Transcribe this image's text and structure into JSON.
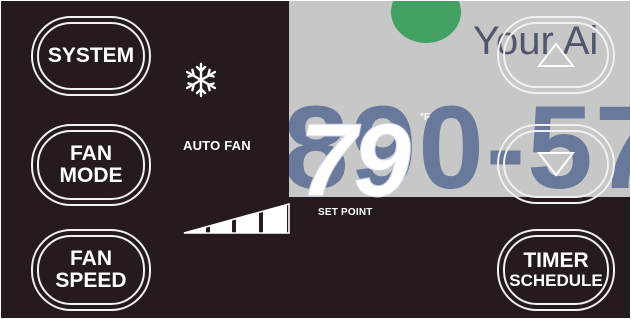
{
  "buttons": {
    "system": "SYSTEM",
    "fan_mode": [
      "FAN",
      "MODE"
    ],
    "fan_speed": [
      "FAN",
      "SPEED"
    ],
    "timer": [
      "TIMER",
      "SCHEDULE"
    ]
  },
  "display": {
    "mode_icon": "snowflake-icon",
    "fan_status": "AUTO FAN",
    "fan_speed_level": "4 of 4 bars",
    "set_point_value": "79",
    "set_point_unit": "°F",
    "set_point_label": "SET POINT"
  },
  "background": {
    "tagline": "Your Ai",
    "phone_fragment": "890-57"
  },
  "colors": {
    "panel": "#251b1f",
    "text": "#ffffff",
    "wash": "#c7c7c7"
  }
}
